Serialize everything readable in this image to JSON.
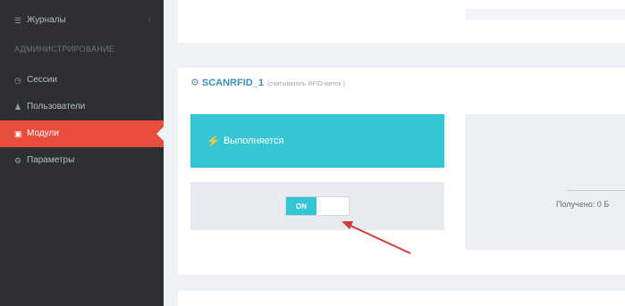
{
  "sidebar": {
    "item_journals": "Журналы",
    "section_label": "АДМИНИСТРИРОВАНИЕ",
    "item_sessions": "Сессии",
    "item_users": "Пользователи",
    "item_modules": "Модули",
    "item_params": "Параметры"
  },
  "module": {
    "title": "SCANRFID_1",
    "subtitle": "(считыватель RFID-меток )",
    "status": "Выполняется",
    "toggle_label": "ON",
    "received_label": "Получено: 0 Б"
  },
  "colors": {
    "sidebar_bg": "#2d2f33",
    "active": "#e74c3c",
    "accent": "#36c6d3",
    "arrow": "#d33a3a"
  }
}
